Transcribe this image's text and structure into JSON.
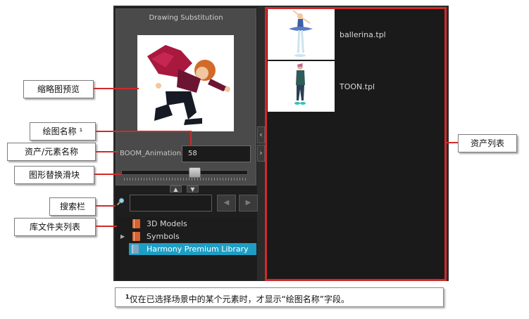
{
  "drawing_substitution": {
    "title": "Drawing Substitution",
    "element_label": "BOOM_Animation",
    "drawing_name_value": "58",
    "slider_value_fraction": 0.58
  },
  "library": {
    "folders": [
      {
        "label": "3D Models",
        "has_children": false,
        "selected": false,
        "icon_color": "#d9622b"
      },
      {
        "label": "Symbols",
        "has_children": true,
        "selected": false,
        "icon_color": "#d9622b"
      },
      {
        "label": "Harmony Premium Library",
        "has_children": false,
        "selected": true,
        "icon_color": "#7fa7c4"
      }
    ]
  },
  "assets": [
    {
      "name": "ballerina.tpl"
    },
    {
      "name": "TOON.tpl"
    }
  ],
  "callouts": {
    "thumbnail_preview": "缩略图预览",
    "drawing_name": "绘图名称 ¹",
    "asset_element_name": "资产/元素名称",
    "substitution_slider": "图形替换滑块",
    "search_bar": "搜索栏",
    "library_folder_list": "库文件夹列表",
    "asset_list": "资产列表"
  },
  "footnote": {
    "marker": "1",
    "text": "仅在已选择场景中的某个元素时，才显示“绘图名称”字段。"
  },
  "colors": {
    "highlight_red": "#d12a2a",
    "selection_blue": "#1e9ec4",
    "panel_dark": "#1a1a1a"
  }
}
